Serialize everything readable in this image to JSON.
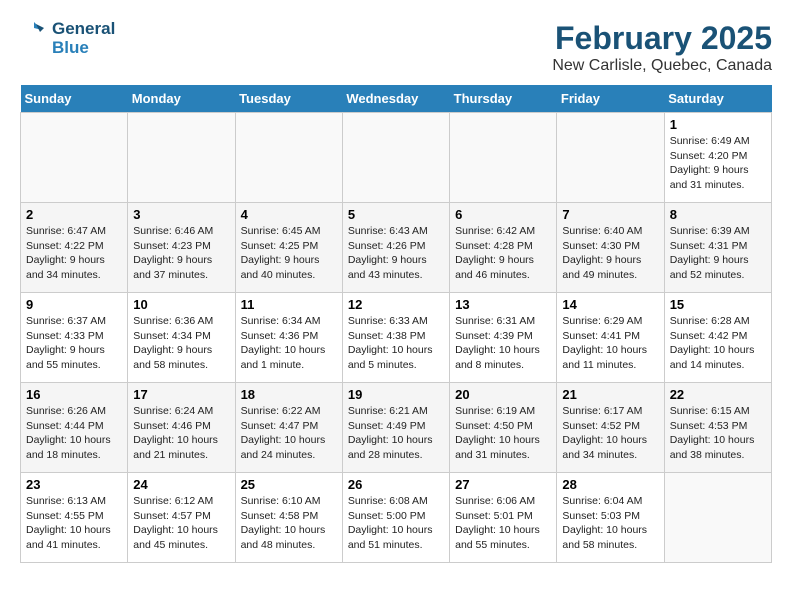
{
  "header": {
    "logo_line1": "General",
    "logo_line2": "Blue",
    "month": "February 2025",
    "location": "New Carlisle, Quebec, Canada"
  },
  "weekdays": [
    "Sunday",
    "Monday",
    "Tuesday",
    "Wednesday",
    "Thursday",
    "Friday",
    "Saturday"
  ],
  "weeks": [
    [
      {
        "day": "",
        "info": ""
      },
      {
        "day": "",
        "info": ""
      },
      {
        "day": "",
        "info": ""
      },
      {
        "day": "",
        "info": ""
      },
      {
        "day": "",
        "info": ""
      },
      {
        "day": "",
        "info": ""
      },
      {
        "day": "1",
        "info": "Sunrise: 6:49 AM\nSunset: 4:20 PM\nDaylight: 9 hours and 31 minutes."
      }
    ],
    [
      {
        "day": "2",
        "info": "Sunrise: 6:47 AM\nSunset: 4:22 PM\nDaylight: 9 hours and 34 minutes."
      },
      {
        "day": "3",
        "info": "Sunrise: 6:46 AM\nSunset: 4:23 PM\nDaylight: 9 hours and 37 minutes."
      },
      {
        "day": "4",
        "info": "Sunrise: 6:45 AM\nSunset: 4:25 PM\nDaylight: 9 hours and 40 minutes."
      },
      {
        "day": "5",
        "info": "Sunrise: 6:43 AM\nSunset: 4:26 PM\nDaylight: 9 hours and 43 minutes."
      },
      {
        "day": "6",
        "info": "Sunrise: 6:42 AM\nSunset: 4:28 PM\nDaylight: 9 hours and 46 minutes."
      },
      {
        "day": "7",
        "info": "Sunrise: 6:40 AM\nSunset: 4:30 PM\nDaylight: 9 hours and 49 minutes."
      },
      {
        "day": "8",
        "info": "Sunrise: 6:39 AM\nSunset: 4:31 PM\nDaylight: 9 hours and 52 minutes."
      }
    ],
    [
      {
        "day": "9",
        "info": "Sunrise: 6:37 AM\nSunset: 4:33 PM\nDaylight: 9 hours and 55 minutes."
      },
      {
        "day": "10",
        "info": "Sunrise: 6:36 AM\nSunset: 4:34 PM\nDaylight: 9 hours and 58 minutes."
      },
      {
        "day": "11",
        "info": "Sunrise: 6:34 AM\nSunset: 4:36 PM\nDaylight: 10 hours and 1 minute."
      },
      {
        "day": "12",
        "info": "Sunrise: 6:33 AM\nSunset: 4:38 PM\nDaylight: 10 hours and 5 minutes."
      },
      {
        "day": "13",
        "info": "Sunrise: 6:31 AM\nSunset: 4:39 PM\nDaylight: 10 hours and 8 minutes."
      },
      {
        "day": "14",
        "info": "Sunrise: 6:29 AM\nSunset: 4:41 PM\nDaylight: 10 hours and 11 minutes."
      },
      {
        "day": "15",
        "info": "Sunrise: 6:28 AM\nSunset: 4:42 PM\nDaylight: 10 hours and 14 minutes."
      }
    ],
    [
      {
        "day": "16",
        "info": "Sunrise: 6:26 AM\nSunset: 4:44 PM\nDaylight: 10 hours and 18 minutes."
      },
      {
        "day": "17",
        "info": "Sunrise: 6:24 AM\nSunset: 4:46 PM\nDaylight: 10 hours and 21 minutes."
      },
      {
        "day": "18",
        "info": "Sunrise: 6:22 AM\nSunset: 4:47 PM\nDaylight: 10 hours and 24 minutes."
      },
      {
        "day": "19",
        "info": "Sunrise: 6:21 AM\nSunset: 4:49 PM\nDaylight: 10 hours and 28 minutes."
      },
      {
        "day": "20",
        "info": "Sunrise: 6:19 AM\nSunset: 4:50 PM\nDaylight: 10 hours and 31 minutes."
      },
      {
        "day": "21",
        "info": "Sunrise: 6:17 AM\nSunset: 4:52 PM\nDaylight: 10 hours and 34 minutes."
      },
      {
        "day": "22",
        "info": "Sunrise: 6:15 AM\nSunset: 4:53 PM\nDaylight: 10 hours and 38 minutes."
      }
    ],
    [
      {
        "day": "23",
        "info": "Sunrise: 6:13 AM\nSunset: 4:55 PM\nDaylight: 10 hours and 41 minutes."
      },
      {
        "day": "24",
        "info": "Sunrise: 6:12 AM\nSunset: 4:57 PM\nDaylight: 10 hours and 45 minutes."
      },
      {
        "day": "25",
        "info": "Sunrise: 6:10 AM\nSunset: 4:58 PM\nDaylight: 10 hours and 48 minutes."
      },
      {
        "day": "26",
        "info": "Sunrise: 6:08 AM\nSunset: 5:00 PM\nDaylight: 10 hours and 51 minutes."
      },
      {
        "day": "27",
        "info": "Sunrise: 6:06 AM\nSunset: 5:01 PM\nDaylight: 10 hours and 55 minutes."
      },
      {
        "day": "28",
        "info": "Sunrise: 6:04 AM\nSunset: 5:03 PM\nDaylight: 10 hours and 58 minutes."
      },
      {
        "day": "",
        "info": ""
      }
    ]
  ]
}
